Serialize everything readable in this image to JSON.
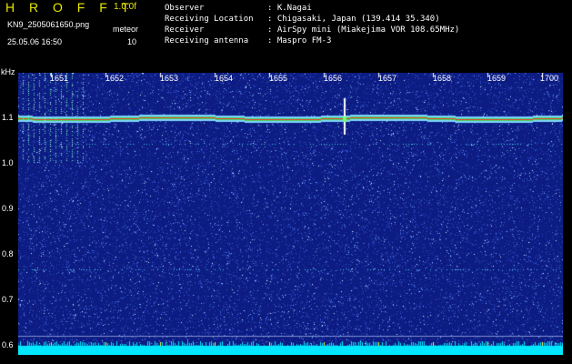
{
  "header": {
    "app_title": "H R O F F T",
    "version": "1.0.0f",
    "file_name": "KN9_2505061650.png",
    "mode_label": "meteor",
    "datetime": "25.05.06 16:50",
    "mode_value": "10"
  },
  "info": [
    {
      "key": "Observer",
      "value": ": K.Nagai"
    },
    {
      "key": "Receiving Location",
      "value": ": Chigasaki, Japan (139.414 35.340)"
    },
    {
      "key": "Receiver",
      "value": ": AirSpy mini (Miakejima VOR 108.65MHz)"
    },
    {
      "key": "Receiving antenna",
      "value": ": Maspro FM-3"
    }
  ],
  "axes": {
    "unit": "kHz",
    "y_labels": [
      "1.1",
      "1.0",
      "0.9",
      "0.8",
      "0.7",
      "0.6"
    ],
    "time_labels": [
      "1651",
      "1652",
      "1653",
      "1654",
      "1655",
      "1656",
      "1657",
      "1658",
      "1659",
      "1700"
    ]
  },
  "colors": {
    "background": "#000000",
    "spectrogram_bg": "#0c1c82",
    "carrier_line": "#ff3030",
    "bottom_band": "#00e8ff",
    "title_text": "#e8e800"
  }
}
